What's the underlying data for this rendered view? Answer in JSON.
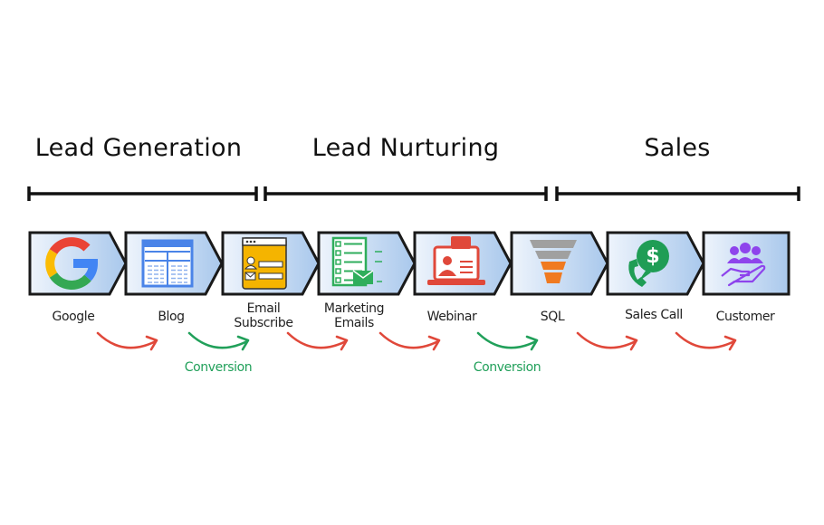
{
  "phases": [
    {
      "label": "Lead Generation"
    },
    {
      "label": "Lead Nurturing"
    },
    {
      "label": "Sales"
    }
  ],
  "steps": [
    {
      "label": "Google",
      "icon": "google-logo-icon"
    },
    {
      "label": "Blog",
      "icon": "blog-layout-icon"
    },
    {
      "label": "Email\nSubscribe",
      "icon": "subscribe-form-icon"
    },
    {
      "label": "Marketing\nEmails",
      "icon": "email-checklist-icon"
    },
    {
      "label": "Webinar",
      "icon": "webinar-presenter-icon"
    },
    {
      "label": "SQL",
      "icon": "funnel-icon"
    },
    {
      "label": "Sales Call",
      "icon": "dollar-phone-icon"
    },
    {
      "label": "Customer",
      "icon": "customer-hand-icon"
    }
  ],
  "transitions": [
    {
      "type": "normal"
    },
    {
      "type": "conversion",
      "label": "Conversion"
    },
    {
      "type": "normal"
    },
    {
      "type": "normal"
    },
    {
      "type": "conversion",
      "label": "Conversion"
    },
    {
      "type": "normal"
    },
    {
      "type": "normal"
    }
  ],
  "colors": {
    "normal_arrow": "#e0483a",
    "conversion_arrow": "#21a05a",
    "box_fill_light": "#eaf2fc",
    "box_fill_dark": "#a9c8ec",
    "border": "#1a1a1a"
  }
}
